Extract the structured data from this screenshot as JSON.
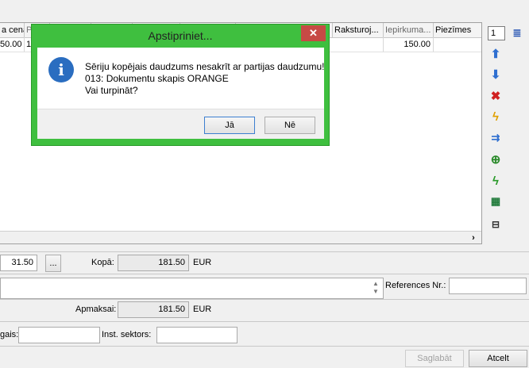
{
  "grid": {
    "columns": [
      {
        "label": "a cena",
        "name": "col-price"
      },
      {
        "label": "P",
        "name": "col-p"
      },
      {
        "label": "",
        "name": "col-3"
      },
      {
        "label": "",
        "name": "col-4"
      },
      {
        "label": "",
        "name": "col-5"
      },
      {
        "label": "",
        "name": "col-6"
      },
      {
        "label": "",
        "name": "col-7"
      },
      {
        "label": "Raksturoj...",
        "name": "col-raksturojums"
      },
      {
        "label": "Iepirkuma...",
        "name": "col-iepirkuma"
      },
      {
        "label": "Piezīmes",
        "name": "col-piezimes"
      }
    ],
    "row": {
      "price": "50.00",
      "p": "1",
      "iepirkuma": "150.00"
    }
  },
  "toolbar": {
    "quantity": "1"
  },
  "form": {
    "field1_value": "31.50",
    "ellipsis": "...",
    "kopa_label": "Kopā:",
    "kopa_value": "181.50",
    "currency1": "EUR",
    "references_label": "References Nr.:",
    "references_value": "",
    "apmaksai_label": "Apmaksai:",
    "apmaksai_value": "181.50",
    "currency2": "EUR",
    "gais_label": "gais:",
    "gais_value": "",
    "inst_label": "Inst. sektors:",
    "inst_value": "",
    "save_label": "Saglabāt",
    "cancel_label": "Atcelt"
  },
  "dialog": {
    "title": "Apstipriniet...",
    "close": "✕",
    "line1": "Sēriju kopējais daudzums nesakrīt ar partijas daudzumu!",
    "line2": "013: Dokumentu skapis ORANGE",
    "line3": "Vai turpināt?",
    "yes_label": "Jā",
    "no_label": "Nē",
    "icon": "i"
  },
  "colors": {
    "dialog_border": "#3fbf3f",
    "close": "#c74a45",
    "info": "#2a6dc0"
  }
}
